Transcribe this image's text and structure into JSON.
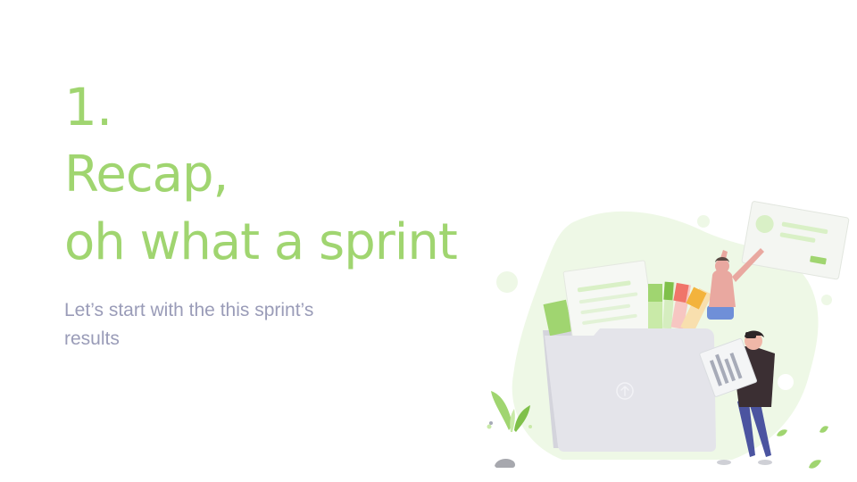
{
  "slide": {
    "number": "1.",
    "title_line1": "Recap,",
    "title_line2": "oh what a sprint",
    "subtitle": "Let’s start with the this sprint’s results"
  },
  "colors": {
    "accent": "#a0d570",
    "subtitle": "#9a9cb8",
    "blob": "#eef8e6",
    "folder": "#e4e4ea"
  },
  "icons": {
    "folder-upload": "upload-icon",
    "plant": "plant-icon"
  }
}
